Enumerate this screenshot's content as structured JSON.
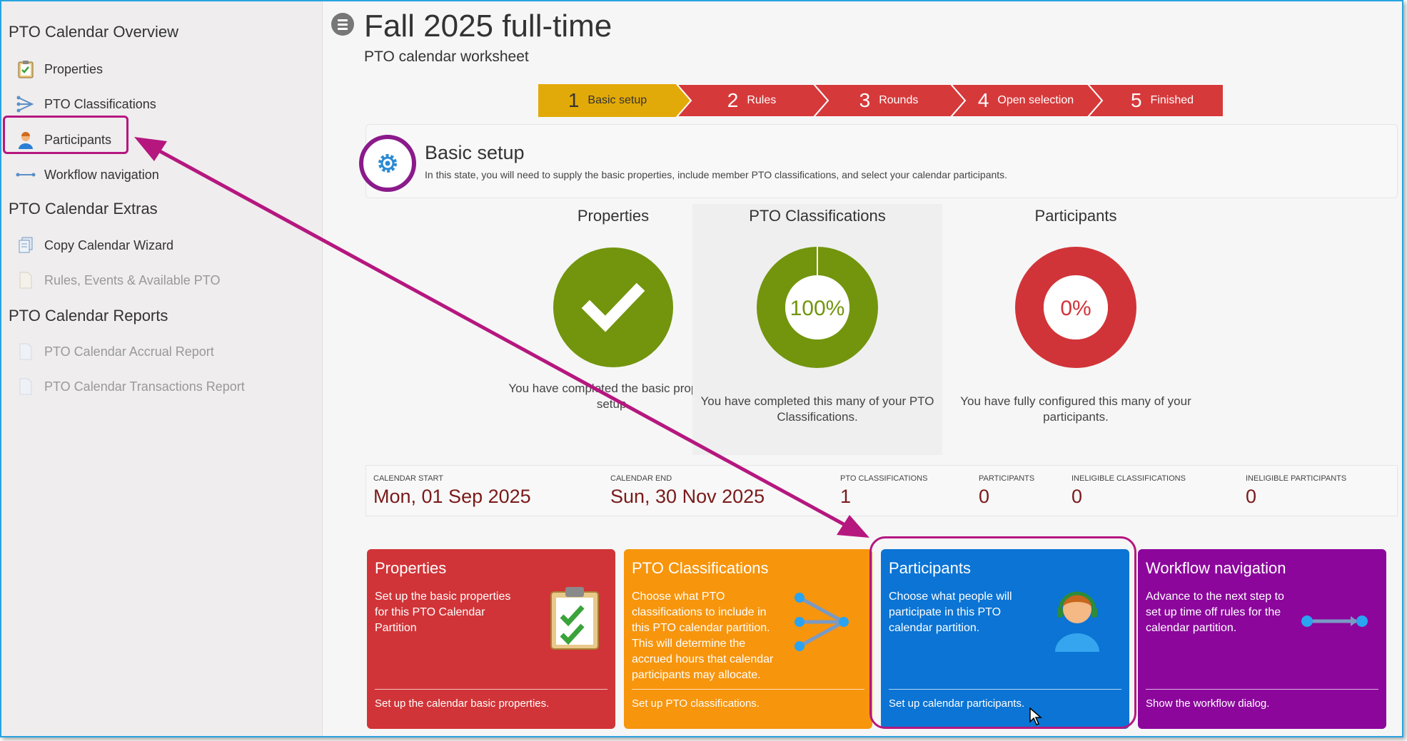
{
  "sidebar": {
    "sections": [
      {
        "title": "PTO Calendar Overview"
      },
      {
        "title": "PTO Calendar Extras"
      },
      {
        "title": "PTO Calendar Reports"
      }
    ],
    "items": [
      {
        "label": "Properties",
        "icon": "clipboard-check-icon"
      },
      {
        "label": "PTO Classifications",
        "icon": "branch-arrow-icon"
      },
      {
        "label": "Participants",
        "icon": "person-headset-icon"
      },
      {
        "label": "Workflow navigation",
        "icon": "workflow-arrow-icon"
      },
      {
        "label": "Copy Calendar Wizard",
        "icon": "copy-document-icon"
      },
      {
        "label": "Rules, Events & Available PTO",
        "icon": "document-icon"
      },
      {
        "label": "PTO Calendar Accrual Report",
        "icon": "report-icon"
      },
      {
        "label": "PTO Calendar Transactions Report",
        "icon": "report-icon"
      }
    ]
  },
  "header": {
    "title": "Fall 2025 full-time",
    "subtitle": "PTO calendar worksheet"
  },
  "steps": [
    {
      "num": "1",
      "label": "Basic setup",
      "color": "#e2aa08"
    },
    {
      "num": "2",
      "label": "Rules",
      "color": "#d6393a"
    },
    {
      "num": "3",
      "label": "Rounds",
      "color": "#d6393a"
    },
    {
      "num": "4",
      "label": "Open selection",
      "color": "#d6393a"
    },
    {
      "num": "5",
      "label": "Finished",
      "color": "#d6393a"
    }
  ],
  "setup": {
    "title": "Basic setup",
    "description": "In this state, you will need to supply the basic properties, include member PTO classifications, and select your calendar participants."
  },
  "progress": [
    {
      "title": "Properties",
      "desc": "You have completed the basic property setup.",
      "percent": 100,
      "color": "#72950d"
    },
    {
      "title": "PTO Classifications",
      "desc": "You have completed this many of your PTO Classifications.",
      "percent_label": "100%",
      "percent": 100,
      "color": "#72950d"
    },
    {
      "title": "Participants",
      "desc": "You have fully configured this many of your participants.",
      "percent_label": "0%",
      "percent": 0,
      "color": "#d13438"
    }
  ],
  "stats": [
    {
      "label": "Calendar Start",
      "value": "Mon, 01 Sep 2025"
    },
    {
      "label": "Calendar End",
      "value": "Sun, 30 Nov 2025"
    },
    {
      "label": "PTO Classifications",
      "value": "1"
    },
    {
      "label": "Participants",
      "value": "0"
    },
    {
      "label": "Ineligible Classifications",
      "value": "0"
    },
    {
      "label": "Ineligible Participants",
      "value": "0"
    }
  ],
  "tiles": [
    {
      "title": "Properties",
      "desc": "Set up the basic properties for this PTO Calendar Partition",
      "footer": "Set up the calendar basic properties.",
      "color": "#d13438"
    },
    {
      "title": "PTO Classifications",
      "desc": "Choose what PTO classifications to include in this PTO calendar partition. This will determine the accrued hours that calendar participants may allocate.",
      "footer": "Set up PTO classifications.",
      "color": "#f7950d"
    },
    {
      "title": "Participants",
      "desc": "Choose what people will participate in this PTO calendar partition.",
      "footer": "Set up calendar participants.",
      "color": "#0b74d4"
    },
    {
      "title": "Workflow navigation",
      "desc": "Advance to the next step to set up time off rules for the calendar partition.",
      "footer": "Show the workflow dialog.",
      "color": "#8c069c"
    }
  ],
  "accent": "#b5177f"
}
